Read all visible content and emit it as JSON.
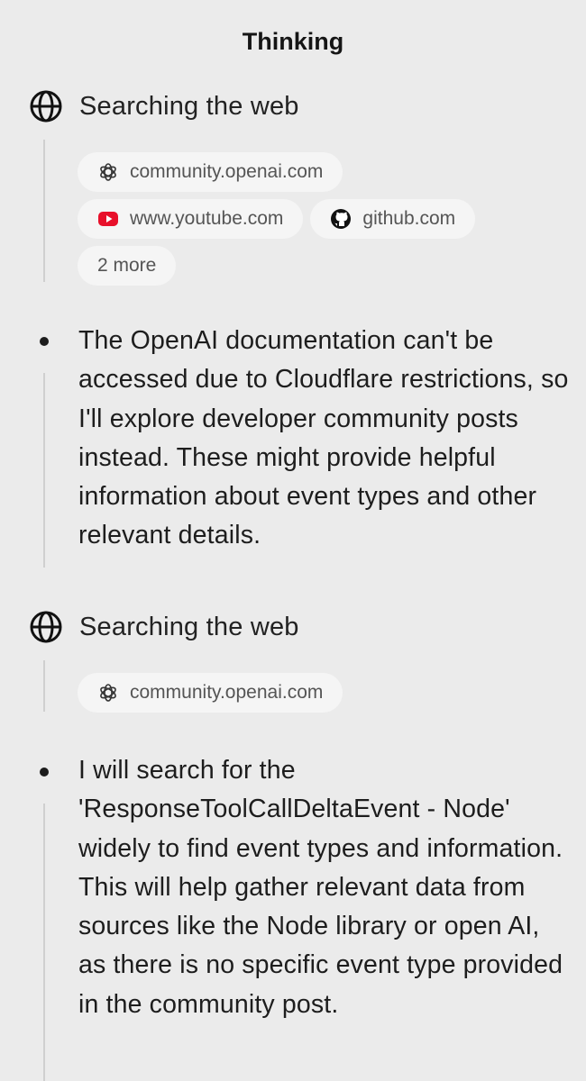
{
  "header": {
    "title": "Thinking"
  },
  "steps": [
    {
      "type": "search",
      "label": "Searching the web",
      "icon": "globe-icon",
      "sources": [
        {
          "label": "community.openai.com",
          "icon": "openai-icon"
        },
        {
          "label": "www.youtube.com",
          "icon": "youtube-icon"
        },
        {
          "label": "github.com",
          "icon": "github-icon"
        },
        {
          "label": "2 more",
          "icon": ""
        }
      ]
    },
    {
      "type": "thought",
      "text": "The OpenAI documentation can't be accessed due to Cloudflare restrictions, so I'll explore developer community posts instead. These might provide helpful information about event types and other relevant details."
    },
    {
      "type": "search",
      "label": "Searching the web",
      "icon": "globe-icon",
      "sources": [
        {
          "label": "community.openai.com",
          "icon": "openai-icon"
        }
      ]
    },
    {
      "type": "thought",
      "text": "I will search for the 'ResponseToolCallDeltaEvent - Node' widely to find event types and information. This will help gather relevant data from sources like the Node library or open AI, as there is no specific event type provided in the community post."
    }
  ],
  "colors": {
    "background": "#ebebeb",
    "chip": "#f5f5f5",
    "youtube": "#e8102a",
    "line": "#cfcfcf"
  }
}
